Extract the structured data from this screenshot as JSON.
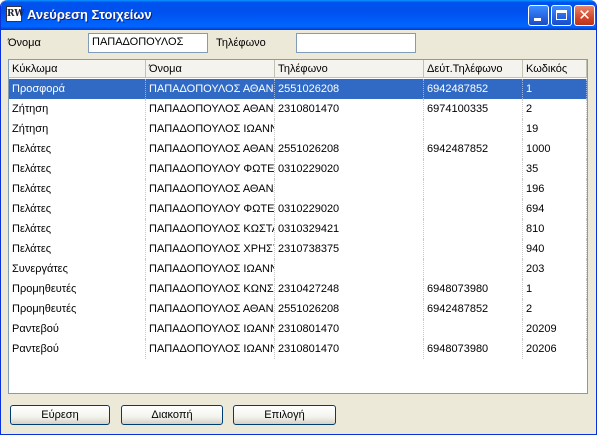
{
  "window": {
    "icon_text": "RW",
    "title": "Ανεύρεση Στοιχείων"
  },
  "filters": {
    "name_label": "Όνομα",
    "name_value": "ΠΑΠΑΔΟΠΟΥΛΟΣ",
    "phone_label": "Τηλέφωνο",
    "phone_value": ""
  },
  "grid": {
    "columns": [
      "Κύκλωμα",
      "Όνομα",
      "Τηλέφωνο",
      "Δεύτ.Τηλέφωνο",
      "Κωδικός"
    ],
    "rows": [
      [
        "Προσφορά",
        "ΠΑΠΑΔΟΠΟΥΛΟΣ ΑΘΑΝΑΣΙΟΣ",
        "2551026208",
        "6942487852",
        "1"
      ],
      [
        "Ζήτηση",
        "ΠΑΠΑΔΟΠΟΥΛΟΣ ΑΘΑΝΑΣΙΟΣ",
        "2310801470",
        "6974100335",
        "2"
      ],
      [
        "Ζήτηση",
        "ΠΑΠΑΔΟΠΟΥΛΟΣ ΙΩΑΝΝΗΣ",
        "",
        "",
        "19"
      ],
      [
        "Πελάτες",
        "ΠΑΠΑΔΟΠΟΥΛΟΣ ΑΘΑΝΑΣΙΟΣ",
        "2551026208",
        "6942487852",
        "1000"
      ],
      [
        "Πελάτες",
        "ΠΑΠΑΔΟΠΟΥΛΟΥ ΦΩΤΕΙΝΗ",
        "0310229020",
        "",
        "35"
      ],
      [
        "Πελάτες",
        "ΠΑΠΑΔΟΠΟΥΛΟΣ ΑΘΑΝΑΣΙΟΣ",
        "",
        "",
        "196"
      ],
      [
        "Πελάτες",
        "ΠΑΠΑΔΟΠΟΥΛΟΥ ΦΩΤΕΙΝΗ",
        "0310229020",
        "",
        "694"
      ],
      [
        "Πελάτες",
        "ΠΑΠΑΔΟΠΟΥΛΟΣ ΚΩΣΤΑΣ",
        "0310329421",
        "",
        "810"
      ],
      [
        "Πελάτες",
        "ΠΑΠΑΔΟΠΟΥΛΟΣ ΧΡΗΣΤΟΣ",
        "2310738375",
        "",
        "940"
      ],
      [
        "Συνεργάτες",
        "ΠΑΠΑΔΟΠΟΥΛΟΣ ΙΩΑΝΝΗΣ",
        "",
        "",
        "203"
      ],
      [
        "Προμηθευτές",
        "ΠΑΠΑΔΟΠΟΥΛΟΣ ΚΩΝΣΤΑΝΤΙΝΟΣ",
        "2310427248",
        "6948073980",
        "1"
      ],
      [
        "Προμηθευτές",
        "ΠΑΠΑΔΟΠΟΥΛΟΣ ΑΘΑΝΑΣΙΟΣ",
        "2551026208",
        "6942487852",
        "2"
      ],
      [
        "Ραντεβού",
        "ΠΑΠΑΔΟΠΟΥΛΟΣ ΙΩΑΝΝΗΣ",
        "2310801470",
        "",
        "20209"
      ],
      [
        "Ραντεβού",
        "ΠΑΠΑΔΟΠΟΥΛΟΣ ΙΩΑΝΝΗΣ",
        "2310801470",
        "6948073980",
        "20206"
      ]
    ],
    "selected_index": 0
  },
  "buttons": {
    "search": "Εύρεση",
    "stop": "Διακοπή",
    "select": "Επιλογή"
  },
  "colors": {
    "title_bar": "#0054e3",
    "selection": "#316ac5",
    "window_bg": "#ece9d8"
  }
}
